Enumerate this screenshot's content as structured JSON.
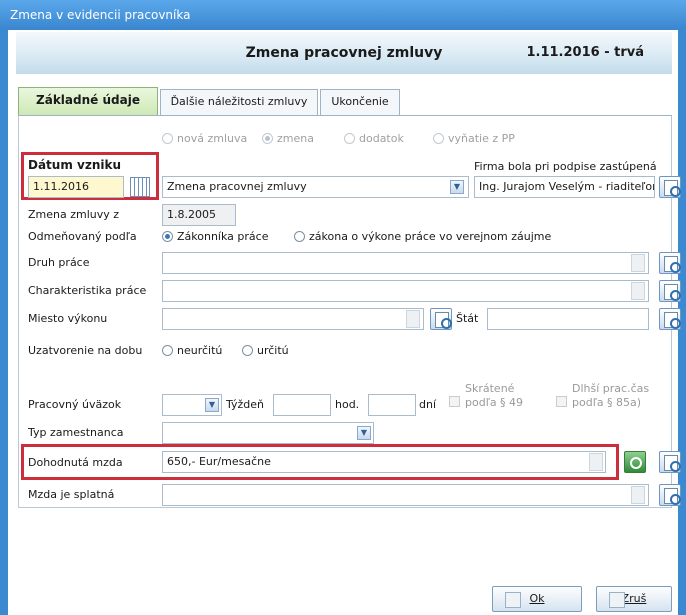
{
  "window": {
    "title": "Zmena v evidencii pracovníka"
  },
  "header": {
    "title": "Zmena pracovnej zmluvy",
    "period": "1.11.2016 - trvá"
  },
  "tabs": [
    {
      "label": "Základné údaje",
      "active": true
    },
    {
      "label": "Ďalšie náležitosti zmluvy",
      "active": false
    },
    {
      "label": "Ukončenie",
      "active": false
    }
  ],
  "contract_type": {
    "options": [
      "nová zmluva",
      "zmena",
      "dodatok",
      "vyňatie z PP"
    ],
    "selected": "zmena"
  },
  "date_origin": {
    "label": "Dátum vzniku",
    "value": "1.11.2016"
  },
  "contract_name": {
    "value": "Zmena pracovnej zmluvy"
  },
  "firm": {
    "label": "Firma bola pri podpise zastúpená",
    "value": "Ing. Jurajom Veselým - riaditeľom"
  },
  "change_from": {
    "label": "Zmena zmluvy z",
    "value": "1.8.2005"
  },
  "remunerated": {
    "label": "Odmeňovaný podľa",
    "options": [
      "Zákonníka práce",
      "zákona o výkone práce vo verejnom záujme"
    ],
    "selected": "Zákonníka práce"
  },
  "work_type": {
    "label": "Druh práce",
    "value": ""
  },
  "work_char": {
    "label": "Charakteristika práce",
    "value": ""
  },
  "place": {
    "label": "Miesto výkonu",
    "value": "",
    "state_label": "Štát",
    "state_value": ""
  },
  "duration": {
    "label": "Uzatvorenie na dobu",
    "options": [
      "neurčitú",
      "určitú"
    ],
    "selected": ""
  },
  "workload": {
    "label": "Pracovný úväzok",
    "week_label": "Týždeň",
    "hours_label": "hod.",
    "days_label": "dní",
    "reduced_label_1": "Skrátené",
    "reduced_label_2": "podľa § 49",
    "longer_label_1": "Dlhší prac.čas",
    "longer_label_2": "podľa § 85a)"
  },
  "employee_type": {
    "label": "Typ zamestnanca",
    "value": ""
  },
  "wage": {
    "label": "Dohodnutá mzda",
    "value": "650,- Eur/mesačne"
  },
  "wage_due": {
    "label": "Mzda je splatná",
    "value": ""
  },
  "buttons": {
    "ok": "Ok",
    "cancel": "Zruš"
  },
  "colors": {
    "highlight": "#cc2f3b",
    "titlebar": "#3b8ad1",
    "active_tab": "#cde8b4"
  }
}
